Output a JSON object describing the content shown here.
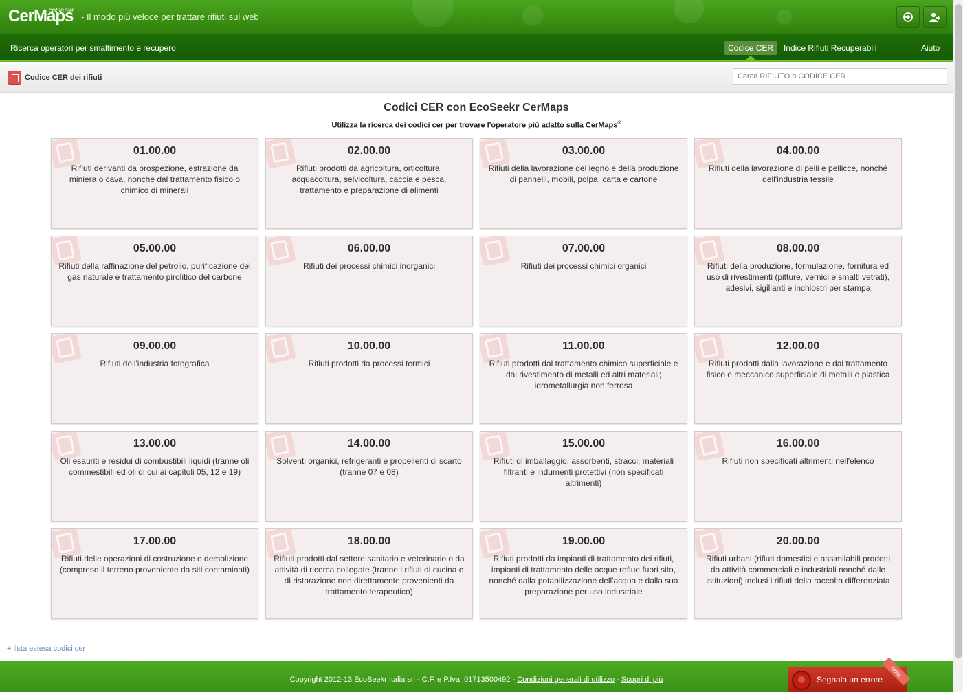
{
  "header": {
    "logo_main": "CerMaps",
    "logo_brand": "EcoSeekr",
    "logo_reg": "®",
    "tagline": "- Il modo più veloce per trattare rifiuti sul web",
    "login_icon": "login-icon",
    "register_icon": "add-user-icon"
  },
  "nav": {
    "left_label": "Ricerca operatori per smaltimento e recupero",
    "items": [
      {
        "label": "Codice CER",
        "active": true
      },
      {
        "label": "Indice Rifiuti Recuperabili",
        "active": false
      },
      {
        "label": "Aiuto",
        "active": false
      }
    ]
  },
  "subbar": {
    "icon": "clipboard-icon",
    "title": "Codice CER dei rifiuti",
    "search_placeholder": "Cerca RIFIUTO o CODICE CER"
  },
  "main": {
    "title": "Codici CER con EcoSeekr CerMaps",
    "subtitle": "Utilizza la ricerca dei codici cer per trovare l'operatore più adatto sulla CerMaps",
    "subtitle_reg": "®",
    "cards": [
      {
        "code": "01.00.00",
        "desc": "Rifiuti derivanti da prospezione, estrazione da miniera o cava, nonché dal trattamento fisico o chimico di minerali"
      },
      {
        "code": "02.00.00",
        "desc": "Rifiuti prodotti da agricoltura, orticoltura, acquacoltura, selvicoltura, caccia e pesca, trattamento e preparazione di alimenti"
      },
      {
        "code": "03.00.00",
        "desc": "Rifiuti della lavorazione del legno e della produzione di pannelli, mobili, polpa, carta e cartone"
      },
      {
        "code": "04.00.00",
        "desc": "Rifiuti della lavorazione di pelli e pellicce, nonché dell'industria tessile"
      },
      {
        "code": "05.00.00",
        "desc": "Rifiuti della raffinazione del petrolio, purificazione del gas naturale e trattamento pirolitico del carbone"
      },
      {
        "code": "06.00.00",
        "desc": "Rifiuti dei processi chimici inorganici"
      },
      {
        "code": "07.00.00",
        "desc": "Rifiuti dei processi chimici organici"
      },
      {
        "code": "08.00.00",
        "desc": "Rifiuti della produzione, formulazione, fornitura ed uso di rivestimenti (pitture, vernici e smalti vetrati), adesivi, sigillanti e inchiostri per stampa"
      },
      {
        "code": "09.00.00",
        "desc": "Rifiuti dell'industria fotografica"
      },
      {
        "code": "10.00.00",
        "desc": "Rifiuti prodotti da processi termici"
      },
      {
        "code": "11.00.00",
        "desc": "Rifiuti prodotti dal trattamento chimico superficiale e dal rivestimento di metalli ed altri materiali; idrometallurgia non ferrosa"
      },
      {
        "code": "12.00.00",
        "desc": "Rifiuti prodotti dalla lavorazione e dal trattamento fisico e meccanico superficiale di metalli e plastica"
      },
      {
        "code": "13.00.00",
        "desc": "Oli esauriti e residui di combustibili liquidi (tranne oli commestibili ed oli di cui ai capitoli 05, 12 e 19)"
      },
      {
        "code": "14.00.00",
        "desc": "Solventi organici, refrigeranti e propellenti di scarto (tranne 07 e 08)"
      },
      {
        "code": "15.00.00",
        "desc": "Rifiuti di imballaggio, assorbenti, stracci, materiali filtranti e indumenti protettivi (non specificati altrimenti)"
      },
      {
        "code": "16.00.00",
        "desc": "Rifiuti non specificati altrimenti nell'elenco"
      },
      {
        "code": "17.00.00",
        "desc": "Rifiuti delle operazioni di costruzione e demolizione (compreso il terreno proveniente da siti contaminati)"
      },
      {
        "code": "18.00.00",
        "desc": "Rifiuti prodotti dal settore sanitario e veterinario o da attività di ricerca collegate (tranne i rifiuti di cucina e di ristorazione non direttamente provenienti da trattamento terapeutico)"
      },
      {
        "code": "19.00.00",
        "desc": "Rifiuti prodotti da impianti di trattamento dei rifiuti, impianti di trattamento delle acque reflue fuori sito, nonché dalla potabilizzazione dell'acqua e dalla sua preparazione per uso industriale"
      },
      {
        "code": "20.00.00",
        "desc": "Rifiuti urbani (rifiuti domestici e assimilabili prodotti da attività commerciali e industriali nonché dalle istituzioni) inclusi i rifiuti della raccolta differenziata"
      }
    ],
    "ext_link": "+ lista estesa codici cer"
  },
  "footer": {
    "copyright": "Copyright 2012-13 EcoSeekr Italia srl - C.F. e P.Iva: 01713500492 - ",
    "link1": "Condizioni generali di utilizzo",
    "sep": " - ",
    "link2": "Scopri di più",
    "report_label": "Segnala un errore",
    "report_badge": "beta",
    "report_icon": "ladybug-icon"
  },
  "colors": {
    "header_green": "#3a8f12",
    "nav_green": "#155b03",
    "card_bg": "#f4eeee",
    "card_icon_red": "#d9534f",
    "footer_green": "#4caa22"
  }
}
